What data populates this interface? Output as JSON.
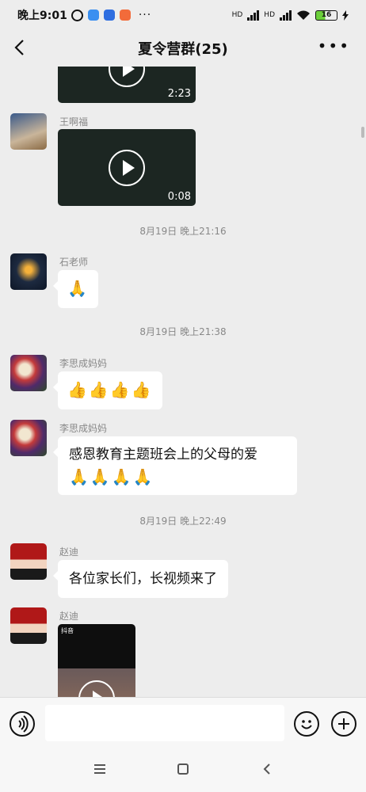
{
  "status": {
    "time": "晚上9:01",
    "dots": "···",
    "hd1": "HD",
    "hd2": "HD",
    "battery": "16"
  },
  "header": {
    "title": "夏令营群(25)"
  },
  "chat": {
    "messages": [
      {
        "type": "video",
        "duration": "2:23"
      },
      {
        "type": "video",
        "sender": "王啊福",
        "duration": "0:08"
      },
      {
        "type": "time",
        "text": "8月19日 晚上21:16"
      },
      {
        "type": "text",
        "sender": "石老师",
        "text": "🙏"
      },
      {
        "type": "time",
        "text": "8月19日 晚上21:38"
      },
      {
        "type": "text",
        "sender": "李思成妈妈",
        "text": "👍👍👍👍"
      },
      {
        "type": "text",
        "sender": "李思成妈妈",
        "text": "感恩教育主题班会上的父母的爱",
        "emoji": "🙏🙏🙏🙏"
      },
      {
        "type": "time",
        "text": "8月19日 晚上22:49"
      },
      {
        "type": "text",
        "sender": "赵迪",
        "text": "各位家长们，长视频来了"
      },
      {
        "type": "video",
        "sender": "赵迪",
        "caption": "抖音"
      }
    ]
  },
  "input": {
    "value": "",
    "placeholder": ""
  },
  "colors": {
    "background": "#ededed",
    "bubble": "#ffffff",
    "timestamp": "#888888"
  }
}
